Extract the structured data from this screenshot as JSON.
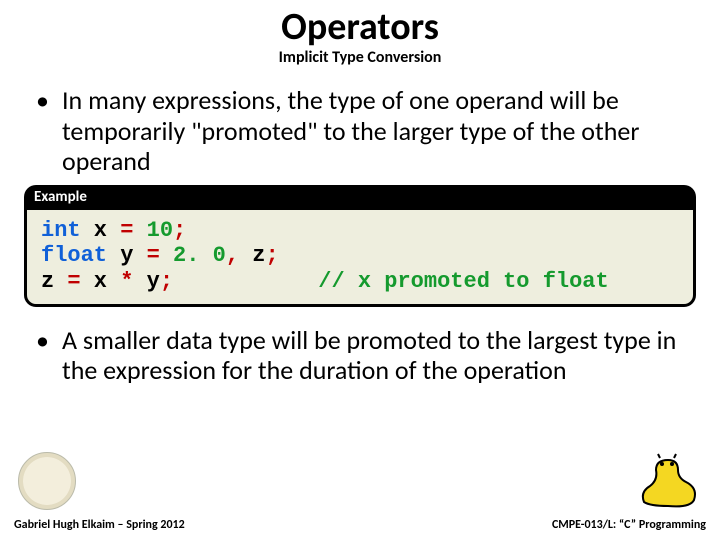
{
  "title": "Operators",
  "subtitle": "Implicit Type Conversion",
  "bullet1": "In many expressions, the type of one operand will be temporarily \"promoted\" to the larger type of the other operand",
  "bullet2": "A smaller data type will be promoted to the largest type in the expression for the duration of the operation",
  "example_label": "Example",
  "code": {
    "l1_kw": "int",
    "l1_a": " x ",
    "l1_eq": "=",
    "l1_b": " ",
    "l1_num": "10",
    "l1_sc": ";",
    "l2_kw": "float",
    "l2_a": " y ",
    "l2_eq": "=",
    "l2_b": " ",
    "l2_num": "2. 0",
    "l2_c": ",",
    "l2_d": " z",
    "l2_sc": ";",
    "l3_a": "z ",
    "l3_eq": "=",
    "l3_b": " x ",
    "l3_op": "*",
    "l3_c": " y",
    "l3_sc": ";",
    "l3_pad": "           ",
    "l3_cmt": "// x promoted to float"
  },
  "footer_left": "Gabriel Hugh Elkaim – Spring 2012",
  "footer_right": "CMPE-013/L: “C” Programming"
}
